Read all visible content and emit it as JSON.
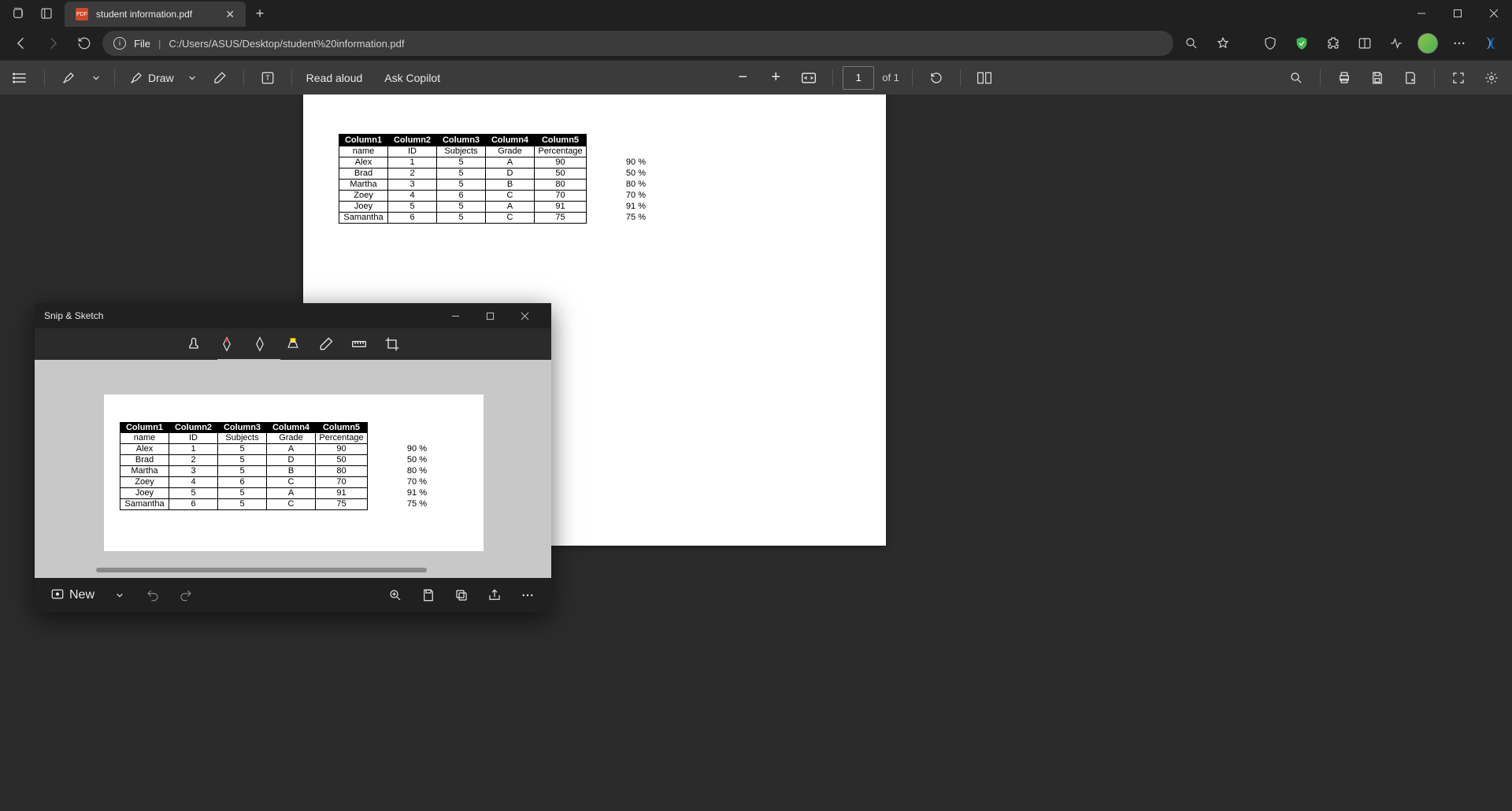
{
  "tab": {
    "title": "student information.pdf"
  },
  "addr": {
    "file_label": "File",
    "separator": "|",
    "path": "C:/Users/ASUS/Desktop/student%20information.pdf"
  },
  "pdfbar": {
    "draw": "Draw",
    "read_aloud": "Read aloud",
    "ask_copilot": "Ask Copilot",
    "page_current": "1",
    "page_total": "of 1"
  },
  "table": {
    "headers": [
      "Column1",
      "Column2",
      "Column3",
      "Column4",
      "Column5"
    ],
    "subheaders": [
      "name",
      "ID",
      "Subjects",
      "Grade",
      "Percentage"
    ],
    "rows": [
      [
        "Alex",
        "1",
        "5",
        "A",
        "90"
      ],
      [
        "Brad",
        "2",
        "5",
        "D",
        "50"
      ],
      [
        "Martha",
        "3",
        "5",
        "B",
        "80"
      ],
      [
        "Zoey",
        "4",
        "6",
        "C",
        "70"
      ],
      [
        "Joey",
        "5",
        "5",
        "A",
        "91"
      ],
      [
        "Samantha",
        "6",
        "5",
        "C",
        "75"
      ]
    ],
    "pct": [
      "90 %",
      "50 %",
      "80 %",
      "70 %",
      "91 %",
      "75 %"
    ]
  },
  "snip": {
    "title": "Snip & Sketch",
    "new": "New"
  }
}
